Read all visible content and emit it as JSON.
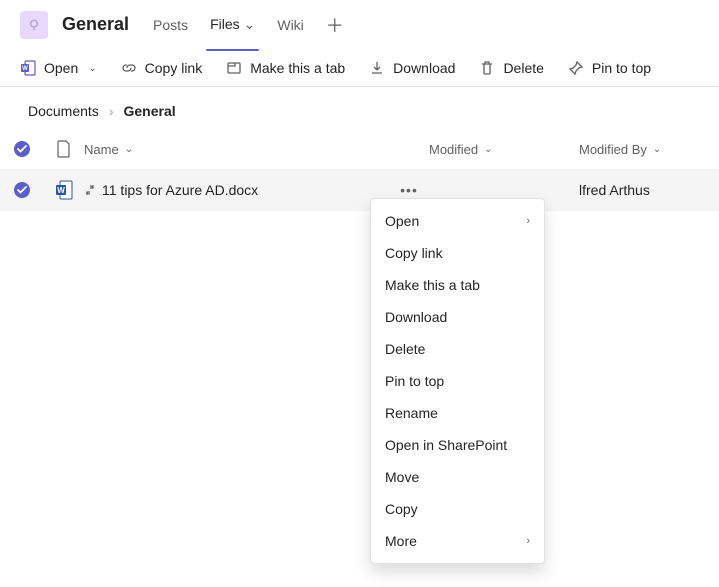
{
  "header": {
    "channel_title": "General",
    "tabs": [
      "Posts",
      "Files",
      "Wiki"
    ],
    "active_tab": "Files"
  },
  "toolbar": {
    "open": "Open",
    "copy_link": "Copy link",
    "make_tab": "Make this a tab",
    "download": "Download",
    "delete": "Delete",
    "pin": "Pin to top"
  },
  "breadcrumb": {
    "root": "Documents",
    "current": "General"
  },
  "columns": {
    "name": "Name",
    "modified": "Modified",
    "modified_by": "Modified By"
  },
  "row": {
    "file_name": "11 tips for Azure AD.docx",
    "modified_by_value": "lfred Arthus"
  },
  "context_menu": {
    "open": "Open",
    "copy_link": "Copy link",
    "make_tab": "Make this a tab",
    "download": "Download",
    "delete": "Delete",
    "pin": "Pin to top",
    "rename": "Rename",
    "open_sp": "Open in SharePoint",
    "move": "Move",
    "copy": "Copy",
    "more": "More"
  }
}
